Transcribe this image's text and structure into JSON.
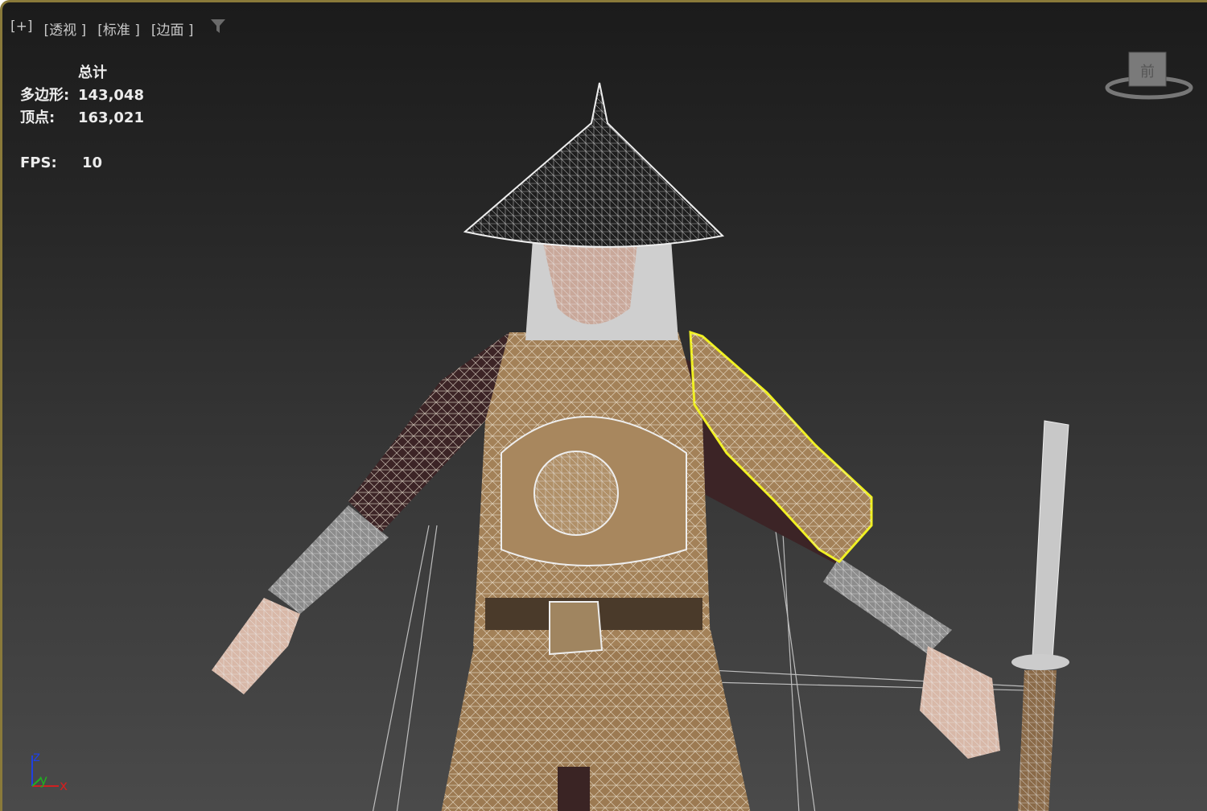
{
  "viewport_menu": {
    "plus": "[+]",
    "view": "[透视 ]",
    "shading": "[标准 ]",
    "display": "[边面 ]"
  },
  "filter_icon": "filter-icon",
  "stats": {
    "header": "总计",
    "polygons_label": "多边形:",
    "polygons": "143,048",
    "vertices_label": "顶点:",
    "vertices": "163,021",
    "fps_label": "FPS:",
    "fps": "10"
  },
  "viewcube": {
    "face_label": "前"
  },
  "axis": {
    "x": "x",
    "y": "y",
    "z": "z"
  },
  "colors": {
    "selection": "#f0f020",
    "frame": "#8a7a3a",
    "x": "#d02020",
    "y": "#20b020",
    "z": "#2040e0"
  }
}
